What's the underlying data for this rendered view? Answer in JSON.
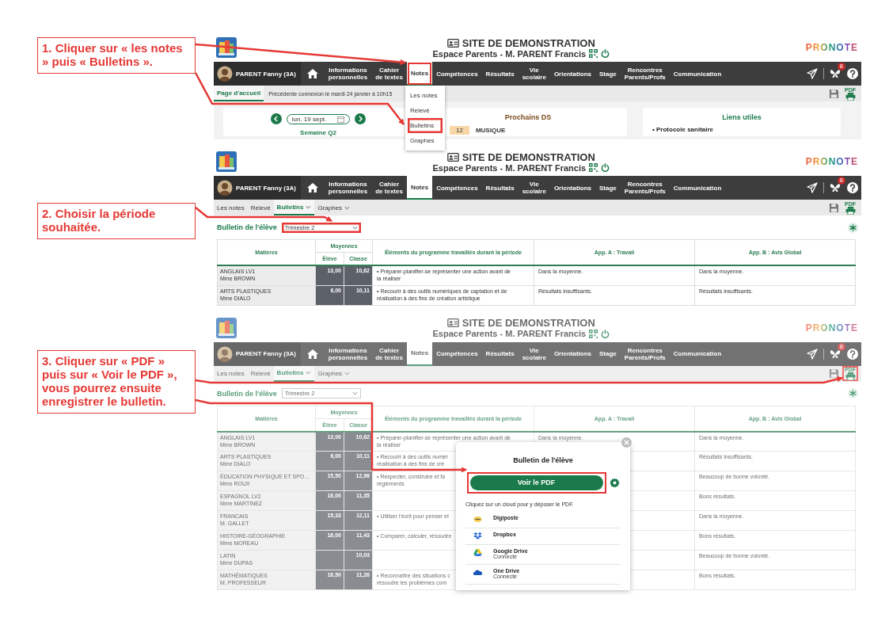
{
  "panels": [
    {
      "kind": "home",
      "callout": "1. Cliquer sur « les notes » puis « Bulletins ».",
      "dimmed": false,
      "header": {
        "title": "SITE DE DEMONSTRATION",
        "subtitle": "Espace Parents - M. PARENT Francis",
        "brand": "PRONOTE"
      },
      "user": "PARENT Fanny (3A)",
      "badge": "8",
      "nav": [
        {
          "label": "Informations\npersonnelles",
          "selected": false,
          "highlighted": false
        },
        {
          "label": "Cahier\nde textes",
          "selected": false,
          "highlighted": false
        },
        {
          "label": "Notes",
          "selected": true,
          "highlighted": true,
          "menu": [
            {
              "label": "Les notes",
              "highlighted": false
            },
            {
              "label": "Relevé",
              "highlighted": false
            },
            {
              "label": "Bulletins",
              "highlighted": true
            },
            {
              "label": "Graphes",
              "highlighted": false
            }
          ]
        },
        {
          "label": "Compétences",
          "selected": false,
          "highlighted": false
        },
        {
          "label": "Résultats",
          "selected": false,
          "highlighted": false
        },
        {
          "label": "Vie\nscolaire",
          "selected": false,
          "highlighted": false
        },
        {
          "label": "Orientations",
          "selected": false,
          "highlighted": false
        },
        {
          "label": "Stage",
          "selected": false,
          "highlighted": false
        },
        {
          "label": "Rencontres\nParents/Profs",
          "selected": false,
          "highlighted": false
        },
        {
          "label": "Communication",
          "selected": false,
          "highlighted": false
        }
      ],
      "subtabs": [
        {
          "label": "Page d'accueil",
          "selected": true,
          "has_menu": false
        }
      ],
      "last_login": "Précédente connexion le mardi 24 janvier à 10h15",
      "pdf_label": "PDF",
      "print_highlighted": false,
      "week_nav": {
        "date": "lun. 19 sept.",
        "week": "Semaine Q2"
      },
      "cards": [
        {
          "kind": "ds",
          "title": "Prochains DS",
          "items": [
            {
              "day": "12",
              "subject": "MUSIQUE"
            }
          ]
        },
        {
          "kind": "links",
          "title": "Liens utiles",
          "items": [
            {
              "label": "• Protocole sanitaire"
            }
          ]
        }
      ]
    },
    {
      "kind": "bulletin",
      "callout": "2. Choisir la période souhaitée.",
      "dimmed": false,
      "header": {
        "title": "SITE DE DEMONSTRATION",
        "subtitle": "Espace Parents - M. PARENT Francis",
        "brand": "PRONOTE"
      },
      "user": "PARENT Fanny (3A)",
      "badge": "8",
      "nav": [
        {
          "label": "Informations\npersonnelles",
          "selected": false,
          "highlighted": false
        },
        {
          "label": "Cahier\nde textes",
          "selected": false,
          "highlighted": false
        },
        {
          "label": "Notes",
          "selected": true,
          "highlighted": false
        },
        {
          "label": "Compétences",
          "selected": false,
          "highlighted": false
        },
        {
          "label": "Résultats",
          "selected": false,
          "highlighted": false
        },
        {
          "label": "Vie\nscolaire",
          "selected": false,
          "highlighted": false
        },
        {
          "label": "Orientations",
          "selected": false,
          "highlighted": false
        },
        {
          "label": "Stage",
          "selected": false,
          "highlighted": false
        },
        {
          "label": "Rencontres\nParents/Profs",
          "selected": false,
          "highlighted": false
        },
        {
          "label": "Communication",
          "selected": false,
          "highlighted": false
        }
      ],
      "subtabs": [
        {
          "label": "Les notes",
          "selected": false,
          "has_menu": false
        },
        {
          "label": "Relevé",
          "selected": false,
          "has_menu": false
        },
        {
          "label": "Bulletins",
          "selected": true,
          "has_menu": true
        },
        {
          "label": "Graphes",
          "selected": false,
          "has_menu": true
        }
      ],
      "pdf_label": "PDF",
      "print_highlighted": false,
      "period": {
        "label": "Bulletin de l'élève",
        "value": "Trimestre 2",
        "highlighted": true
      },
      "table": {
        "columns": [
          "Matières",
          "Moyennes",
          "Élève",
          "Classe",
          "Éléments du programme travaillés durant la période",
          "App. A : Travail",
          "App. B : Avis Global"
        ],
        "rows": [
          {
            "subject": "ANGLAIS LV1",
            "teacher": "Mme BROWN",
            "student": "13,00",
            "class": "10,62",
            "program": "• Préparer-planifier-se représenter une action avant de\nla réaliser",
            "app_a": "Dans la moyenne.",
            "app_b": "Dans la moyenne."
          },
          {
            "subject": "ARTS PLASTIQUES",
            "teacher": "Mme DIALO",
            "student": "6,00",
            "class": "10,11",
            "program": "• Recourir à des outils numériques de captation et de\nréalisation à des fins de création artistique",
            "app_a": "Résultats insuffisants.",
            "app_b": "Résultats insuffisants."
          }
        ]
      }
    },
    {
      "kind": "bulletin",
      "callout": "3. Cliquer sur « PDF » puis sur « Voir le PDF », vous pourrez ensuite enregistrer le bulletin.",
      "dimmed": true,
      "header": {
        "title": "SITE DE DEMONSTRATION",
        "subtitle": "Espace Parents - M. PARENT Francis",
        "brand": "PRONOTE"
      },
      "user": "PARENT Fanny (3A)",
      "badge": "8",
      "nav": [
        {
          "label": "Informations\npersonnelles",
          "selected": false,
          "highlighted": false
        },
        {
          "label": "Cahier\nde textes",
          "selected": false,
          "highlighted": false
        },
        {
          "label": "Notes",
          "selected": true,
          "highlighted": false
        },
        {
          "label": "Compétences",
          "selected": false,
          "highlighted": false
        },
        {
          "label": "Résultats",
          "selected": false,
          "highlighted": false
        },
        {
          "label": "Vie\nscolaire",
          "selected": false,
          "highlighted": false
        },
        {
          "label": "Orientations",
          "selected": false,
          "highlighted": false
        },
        {
          "label": "Stage",
          "selected": false,
          "highlighted": false
        },
        {
          "label": "Rencontres\nParents/Profs",
          "selected": false,
          "highlighted": false
        },
        {
          "label": "Communication",
          "selected": false,
          "highlighted": false
        }
      ],
      "subtabs": [
        {
          "label": "Les notes",
          "selected": false,
          "has_menu": false
        },
        {
          "label": "Relevé",
          "selected": false,
          "has_menu": false
        },
        {
          "label": "Bulletins",
          "selected": true,
          "has_menu": true
        },
        {
          "label": "Graphes",
          "selected": false,
          "has_menu": true
        }
      ],
      "pdf_label": "PDF",
      "print_highlighted": true,
      "period": {
        "label": "Bulletin de l'élève",
        "value": "Trimestre 2",
        "highlighted": false
      },
      "table": {
        "columns": [
          "Matières",
          "Moyennes",
          "Élève",
          "Classe",
          "Éléments du programme travaillés durant la période",
          "App. A : Travail",
          "App. B : Avis Global"
        ],
        "rows": [
          {
            "subject": "ANGLAIS LV1",
            "teacher": "Mme BROWN",
            "student": "13,00",
            "class": "10,62",
            "program": "• Préparer-planifier-se représenter une action avant de\nla réaliser",
            "app_a": "Dans la moyenne.",
            "app_b": "Dans la moyenne."
          },
          {
            "subject": "ARTS PLASTIQUES",
            "teacher": "Mme DIALO",
            "student": "6,00",
            "class": "10,11",
            "program": "• Recourir à des outils numér\nréalisation à des fins de cré",
            "app_b": "Résultats insuffisants."
          },
          {
            "subject": "ÉDUCATION PHYSIQUE ET SPO…",
            "teacher": "Mme ROUX",
            "student": "15,50",
            "class": "12,98",
            "program": "• Respecter, construire et fa\nrèglements",
            "app_b": "Beaucoup de bonne volonté."
          },
          {
            "subject": "ESPAGNOL LV2",
            "teacher": "Mme MARTINEZ",
            "student": "16,00",
            "class": "11,35",
            "app_b": "Bons résultats."
          },
          {
            "subject": "FRANCAIS",
            "teacher": "M. GALLET",
            "student": "15,33",
            "class": "12,11",
            "program": "• Utiliser l'écrit pour penser et",
            "app_b": "Dans la moyenne."
          },
          {
            "subject": "HISTOIRE-GÉOGRAPHIE",
            "teacher": "Mme MOREAU",
            "student": "16,00",
            "class": "11,43",
            "program": "• Comparer, calculer, résoudre",
            "app_b": "Bons résultats."
          },
          {
            "subject": "LATIN",
            "teacher": "Mme DUPAS",
            "class": "10,03",
            "app_b": "Beaucoup de bonne volonté."
          },
          {
            "subject": "MATHÉMATIQUES",
            "teacher": "M. PROFESSEUR",
            "student": "16,50",
            "class": "11,26",
            "program": "• Reconnaître des situations c\nrésoudre les problèmes com",
            "app_b": "Bons résultats."
          }
        ]
      },
      "dialog": {
        "title": "Bulletin de l'élève",
        "button": "Voir le PDF",
        "button_highlighted": true,
        "hint": "Cliquez sur un cloud pour y déposer le PDF.",
        "services": [
          {
            "kind": "digiposte",
            "name": "Digiposte"
          },
          {
            "kind": "dropbox",
            "name": "Dropbox"
          },
          {
            "kind": "drive",
            "name": "Google Drive",
            "status": "Connecté"
          },
          {
            "kind": "onedrive",
            "name": "One Drive",
            "status": "Connecté"
          }
        ]
      }
    }
  ]
}
